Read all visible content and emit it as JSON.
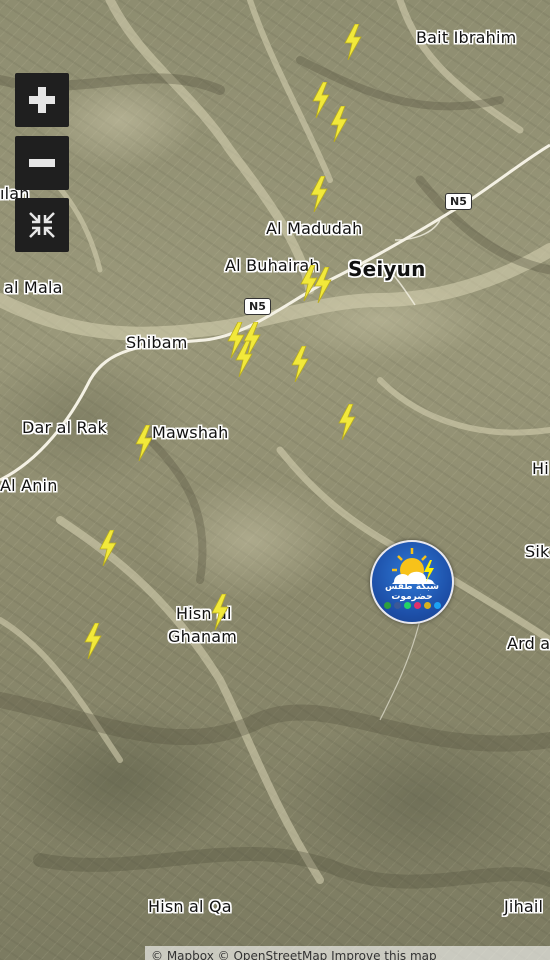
{
  "map": {
    "provider_style": "satellite",
    "lightning_color": "#f2e93a",
    "road_color": "#f4f1e4",
    "places": [
      {
        "id": "bait-ibrahim",
        "label": "Bait Ibrahim"
      },
      {
        "id": "al-madudah",
        "label": "Al Madudah"
      },
      {
        "id": "al-buhairah",
        "label": "Al Buhairah"
      },
      {
        "id": "seiyun",
        "label": "Seiyun"
      },
      {
        "id": "al-mala",
        "label": "al Mala"
      },
      {
        "id": "shibam",
        "label": "Shibam"
      },
      {
        "id": "dar-al-rak",
        "label": "Dar al Rak"
      },
      {
        "id": "mawshah",
        "label": "Mawshah"
      },
      {
        "id": "al-anin",
        "label": "Al Anin"
      },
      {
        "id": "hisn-al-ghanam-1",
        "label": "Hisn al"
      },
      {
        "id": "hisn-al-ghanam-2",
        "label": "Ghanam"
      },
      {
        "id": "hisn-al-qa",
        "label": "Hisn al Qa"
      },
      {
        "id": "jihail",
        "label": "Jihail"
      },
      {
        "id": "ard-a",
        "label": "Ard a"
      },
      {
        "id": "sik",
        "label": "Sik"
      },
      {
        "id": "hi",
        "label": "Hi"
      },
      {
        "id": "edge-ilan",
        "label": "ılan"
      }
    ],
    "road_shields": [
      {
        "id": "n5-east",
        "label": "N5"
      },
      {
        "id": "n5-west",
        "label": "N5"
      }
    ]
  },
  "controls": {
    "zoom_in_icon": "plus-icon",
    "zoom_out_icon": "minus-icon",
    "fullscreen_icon": "collapse-arrows-icon"
  },
  "logo": {
    "brand_text": "شبكة طقس حضرموت",
    "social_colors": [
      "#2e9e3e",
      "#3b5998",
      "#25d366",
      "#e1306c",
      "#d4b21f",
      "#1da1f2"
    ]
  },
  "attribution": {
    "text": "© Mapbox © OpenStreetMap Improve this map"
  }
}
